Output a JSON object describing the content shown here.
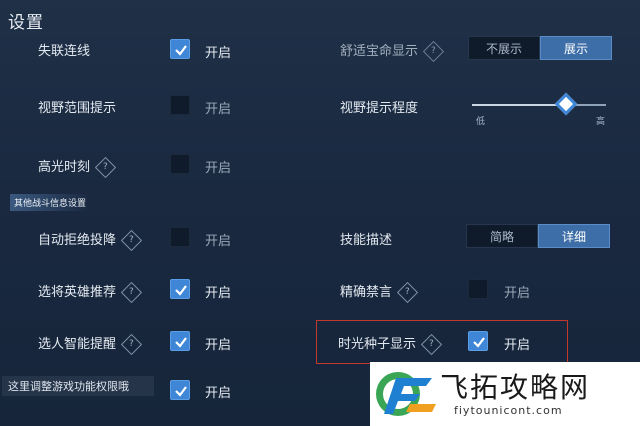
{
  "title": "设置",
  "section_title": "其他战斗信息设置",
  "left_rows": [
    {
      "label": "失联连线",
      "help": false,
      "checked": true,
      "state": "开启"
    },
    {
      "label": "视野范围提示",
      "help": false,
      "checked": false,
      "state": "开启"
    },
    {
      "label": "高光时刻",
      "help": true,
      "checked": false,
      "state": "开启"
    },
    {
      "label": "自动拒绝投降",
      "help": true,
      "checked": false,
      "state": "开启"
    },
    {
      "label": "选将英雄推荐",
      "help": true,
      "checked": true,
      "state": "开启"
    },
    {
      "label": "选人智能提醒",
      "help": true,
      "checked": true,
      "state": "开启"
    },
    {
      "label": "",
      "help": false,
      "checked": true,
      "state": "开启"
    }
  ],
  "right_top": {
    "label": "舒适宝命显示",
    "options": [
      "不展示",
      "展示"
    ],
    "selected": 1
  },
  "vision_slider": {
    "label": "视野提示程度",
    "min_label": "低",
    "max_label": "高",
    "level": 0.78
  },
  "skill_desc": {
    "label": "技能描述",
    "options": [
      "简略",
      "详细"
    ],
    "selected": 1
  },
  "precise_mute": {
    "label": "精确禁言",
    "help": true,
    "checked": false,
    "state": "开启"
  },
  "time_seed": {
    "label": "时光种子显示",
    "help": true,
    "checked": true,
    "state": "开启"
  },
  "tooltip": "这里调整游戏功能权限哦",
  "watermark": {
    "name": "飞拓攻略网",
    "url": "fiytounicont.com"
  },
  "help_glyph": "?",
  "colors": {
    "accent": "#3f87d6",
    "highlight_box": "#c0392b"
  }
}
